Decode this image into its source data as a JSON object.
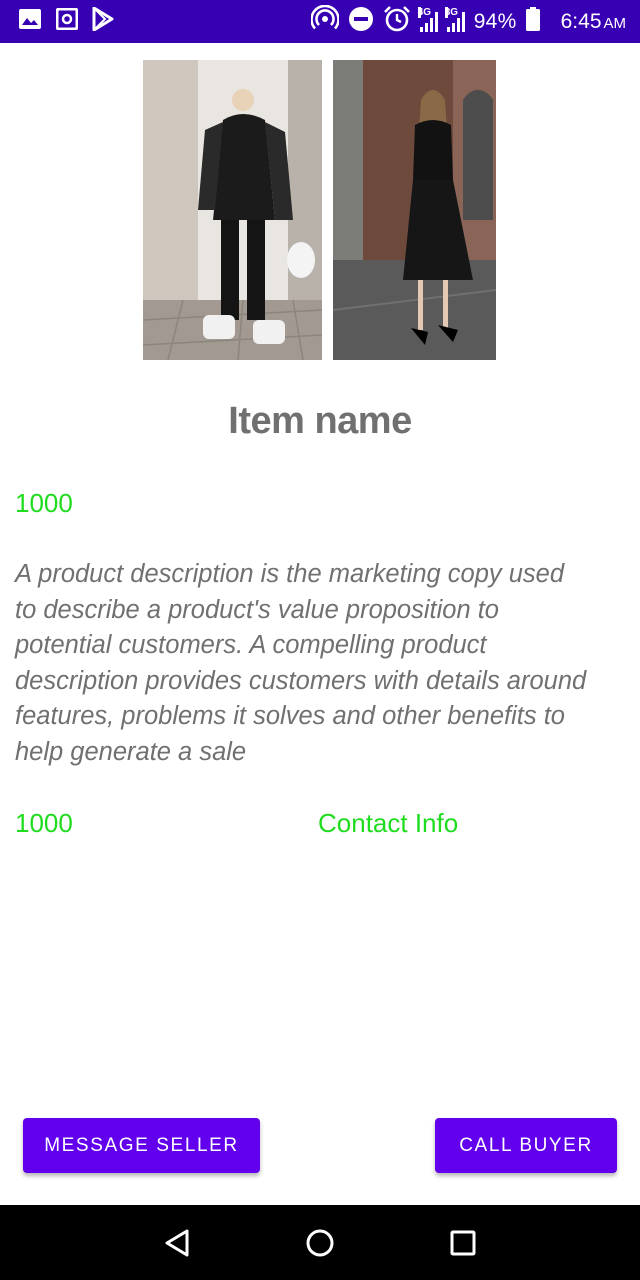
{
  "status_bar": {
    "network_4g": "4G",
    "network_3g": "3G",
    "battery": "94%",
    "time": "6:45",
    "ampm": "AM"
  },
  "item": {
    "name": "Item name",
    "price": "1000",
    "description": "A product description is the marketing copy used to describe a product's value proposition to potential customers. A compelling product description provides customers with details around features, problems it solves and other benefits to help generate a sale",
    "price_secondary": "1000",
    "contact_label": "Contact Info"
  },
  "actions": {
    "message_seller": "MESSAGE SELLER",
    "call_buyer": "CALL BUYER"
  },
  "icons": {
    "status_left": [
      "image-icon",
      "screenshot-icon",
      "play-store-icon"
    ],
    "status_right": [
      "hotspot-icon",
      "do-not-disturb-icon",
      "alarm-icon",
      "signal-4g-icon",
      "signal-3g-icon",
      "battery-icon"
    ],
    "nav": [
      "back-icon",
      "home-icon",
      "recents-icon"
    ]
  },
  "colors": {
    "status_bar": "#3700b3",
    "accent": "#6200ee",
    "price_green": "#1fdc1f",
    "text_grey": "#707070"
  }
}
